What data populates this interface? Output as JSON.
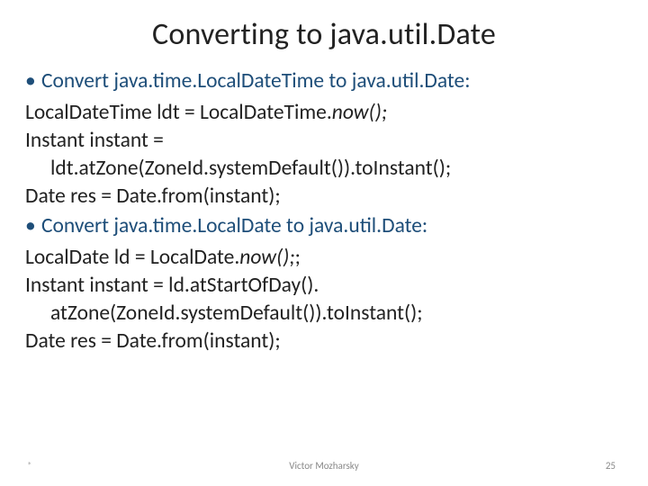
{
  "title": "Converting to java.util.Date",
  "bullets": [
    "Convert java.time.LocalDateTime to java.util.Date:",
    "Convert java.time.LocalDate to java.util.Date:"
  ],
  "block1": {
    "l1a": "LocalDateTime ldt = LocalDateTime.",
    "l1b": "now();",
    "l2": "Instant instant =",
    "l3": "ldt.atZone(ZoneId.systemDefault()).toInstant();",
    "l4": "Date res = Date.from(instant);"
  },
  "block2": {
    "l1a": "LocalDate ld = LocalDate.",
    "l1b": "now();",
    "l1c": ";",
    "l2": "Instant instant = ld.atStartOfDay().",
    "l3": "atZone(ZoneId.systemDefault()).toInstant();",
    "l4": "Date res = Date.from(instant);"
  },
  "footer": {
    "star": "*",
    "author": "Victor Mozharsky",
    "page": "25"
  }
}
